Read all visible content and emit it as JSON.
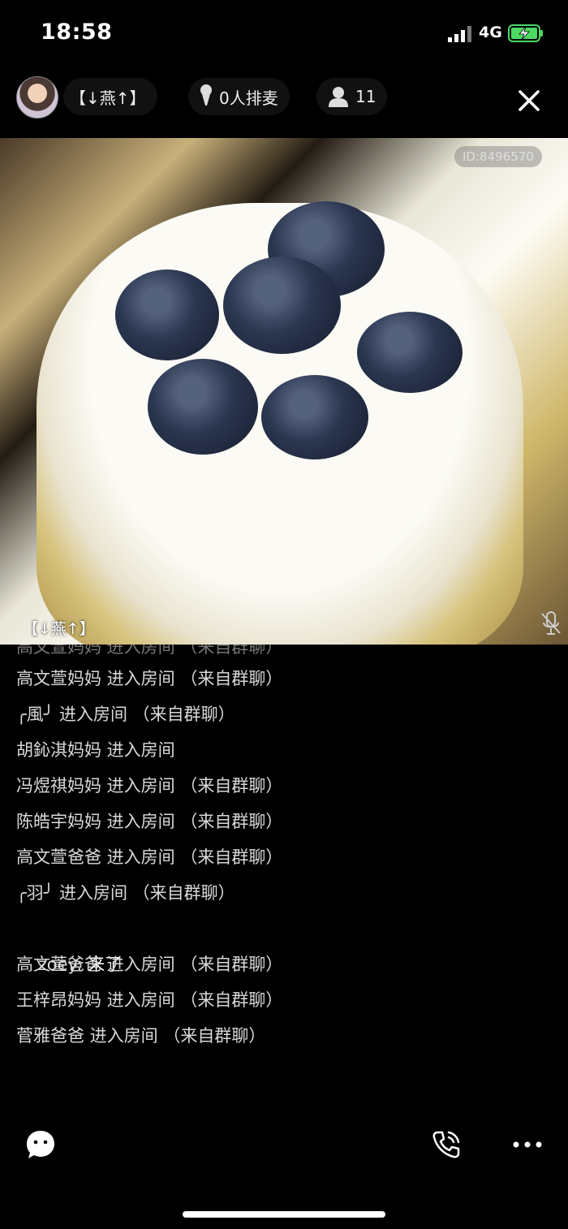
{
  "status_bar": {
    "time": "18:58",
    "network": "4G"
  },
  "header": {
    "room_title": "【↓燕↑】",
    "mic_queue": "0人排麦",
    "viewer_count": "11"
  },
  "video": {
    "room_id": "ID:8496570",
    "host_label": "【↓燕↑】"
  },
  "chat": {
    "lines": [
      {
        "text": "高文萱妈妈 进入房间 （来自群聊）",
        "type": "system",
        "partial": true
      },
      {
        "text": "高文萱妈妈 进入房间 （来自群聊）",
        "type": "system"
      },
      {
        "text": "╭風╯ 进入房间 （来自群聊）",
        "type": "system"
      },
      {
        "text": "胡鈊淇妈妈 进入房间",
        "type": "system"
      },
      {
        "text": "冯煜祺妈妈 进入房间 （来自群聊）",
        "type": "system"
      },
      {
        "text": "陈皓宇妈妈 进入房间 （来自群聊）",
        "type": "system"
      },
      {
        "text": "高文萱爸爸 进入房间 （来自群聊）",
        "type": "system"
      },
      {
        "text": "╭羽╯ 进入房间 （来自群聊）",
        "type": "system"
      },
      {
        "user": "zoey: ",
        "content": "来了",
        "type": "message"
      },
      {
        "text": "高文萱爸爸 进入房间 （来自群聊）",
        "type": "system"
      },
      {
        "text": "王梓昂妈妈 进入房间 （来自群聊）",
        "type": "system"
      },
      {
        "text": "菅雅爸爸 进入房间 （来自群聊）",
        "type": "system"
      }
    ]
  },
  "icons": {
    "status": [
      "signal-icon",
      "battery-charging-icon"
    ],
    "header": [
      "avatar",
      "microphone-icon",
      "user-icon",
      "close-icon"
    ],
    "video": [
      "mic-muted-icon"
    ],
    "toolbar": [
      "chat-bubble-icon",
      "phone-call-icon",
      "more-icon"
    ]
  },
  "colors": {
    "background": "#000000",
    "battery": "#4cd964"
  }
}
